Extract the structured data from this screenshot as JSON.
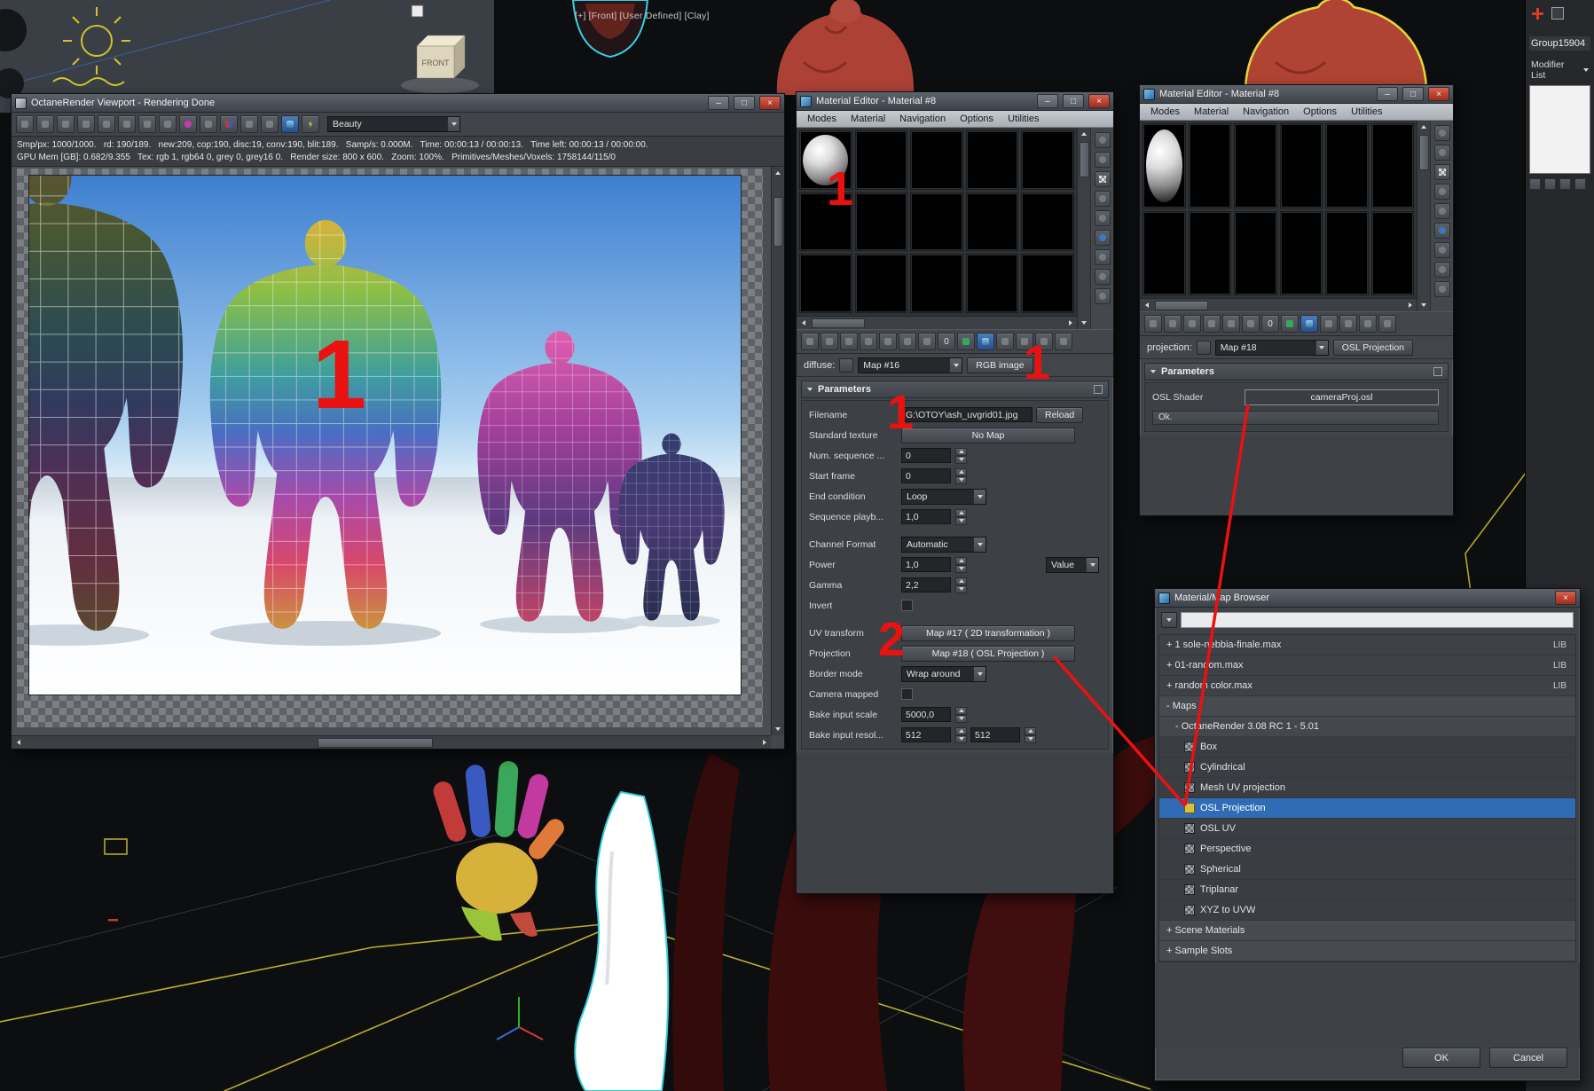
{
  "colors": {
    "annotation_red": "#ea1111",
    "selection_blue": "#2f6cb5",
    "close_button_red": "#a12c1c",
    "window_panel": "#42454a",
    "viewport_background": "#0d0e10"
  },
  "window_controls": {
    "minimize": "–",
    "maximize": "□",
    "close": "×"
  },
  "viewport": {
    "label": "[+] [Front] [User Defined] [Clay]",
    "gizmo_label": "FRONT",
    "scene_group": "Group15904",
    "modifier_list": "Modifier List"
  },
  "annotations": {
    "marks": [
      {
        "text": "1"
      },
      {
        "text": "1"
      },
      {
        "text": "1"
      },
      {
        "text": "1"
      },
      {
        "text": "2"
      }
    ]
  },
  "octane_window": {
    "title": "OctaneRender Viewport - Rendering Done",
    "render_pass": "Beauty",
    "stats_line1": "Smp/px: 1000/1000.   rd: 190/189.   new:209, cop:190, disc:19, conv:190, blit:189.   Samp/s: 0.000M.   Time: 00:00:13 / 00:00:13.   Time left: 00:00:13 / 00:00:00.",
    "stats_line2": "GPU Mem [GB]: 0.682/9.355   Tex: rgb 1, rgb64 0, grey 0, grey16 0.   Render size: 800 x 600.   Zoom: 100%.   Primitives/Meshes/Voxels: 1758144/115/0",
    "toolbar_icons": [
      "render-settings-icon",
      "save-image-icon",
      "copy-image-icon",
      "lock-resolution-icon",
      "pause-render-icon",
      "restart-render-icon",
      "stop-render-icon",
      "focus-picker-icon",
      "material-picker-icon",
      "white-balance-picker-icon",
      "render-region-icon",
      "film-region-icon",
      "clay-mode-icon",
      "render-passes-icon",
      "subsample-icon"
    ]
  },
  "material_editor_left": {
    "title": "Material Editor - Material #8",
    "menus": [
      "Modes",
      "Material",
      "Navigation",
      "Options",
      "Utilities"
    ],
    "channel": {
      "label": "diffuse:",
      "map": "Map #16",
      "type_button": "RGB image"
    },
    "toolbar": {
      "material_id": "0"
    },
    "toolbar_icons": [
      "get-material-icon",
      "put-to-scene-icon",
      "assign-to-selection-icon",
      "reset-map-icon",
      "make-unique-icon",
      "put-to-library-icon",
      "material-id-channel-icon",
      "show-map-in-viewport-icon",
      "show-end-result-icon",
      "go-to-parent-icon",
      "go-forward-sibling-icon",
      "material-id-badge",
      "sample-uv-tiling-icon",
      "pin-panel-icon"
    ],
    "side_icons": [
      "sample-type-icon",
      "backlight-icon",
      "background-checker-icon",
      "sample-tiling-icon",
      "video-color-check-icon",
      "make-preview-icon",
      "editor-options-icon",
      "select-by-material-icon",
      "material-map-navigator-icon"
    ],
    "parameters": {
      "header": "Parameters",
      "filename": {
        "label": "Filename",
        "value": "G:\\OTOY\\ash_uvgrid01.jpg",
        "button": "Reload"
      },
      "standard_texture": {
        "label": "Standard texture",
        "value": "No Map"
      },
      "num_sequence": {
        "label": "Num. sequence ...",
        "value": "0"
      },
      "start_frame": {
        "label": "Start frame",
        "value": "0"
      },
      "end_condition": {
        "label": "End condition",
        "value": "Loop"
      },
      "sequence_playback": {
        "label": "Sequence playb...",
        "value": "1,0"
      },
      "channel_format": {
        "label": "Channel Format",
        "value": "Automatic"
      },
      "power": {
        "label": "Power",
        "value": "1,0",
        "mode": "Value"
      },
      "gamma": {
        "label": "Gamma",
        "value": "2,2"
      },
      "invert": {
        "label": "Invert",
        "checked": false
      },
      "uv_transform": {
        "label": "UV transform",
        "value": "Map #17  ( 2D transformation )"
      },
      "projection": {
        "label": "Projection",
        "value": "Map #18  ( OSL Projection )"
      },
      "border_mode": {
        "label": "Border mode",
        "value": "Wrap around"
      },
      "camera_mapped": {
        "label": "Camera mapped",
        "checked": false
      },
      "bake_input_scale": {
        "label": "Bake input scale",
        "value": "5000,0"
      },
      "bake_input_resolution": {
        "label": "Bake input resol...",
        "value1": "512",
        "value2": "512"
      }
    }
  },
  "material_editor_right": {
    "title": "Material Editor - Material #8",
    "menus": [
      "Modes",
      "Material",
      "Navigation",
      "Options",
      "Utilities"
    ],
    "channel": {
      "label": "projection:",
      "map": "Map #18",
      "type_button": "OSL Projection"
    },
    "toolbar": {
      "material_id": "0"
    },
    "parameters": {
      "header": "Parameters",
      "osl_shader": {
        "label": "OSL Shader",
        "value": "cameraProj.osl"
      },
      "ok_button": "Ok."
    }
  },
  "map_browser": {
    "title": "Material/Map Browser",
    "search_value": "",
    "rows": [
      {
        "label": "+ 1 sole-nebbia-finale.max",
        "tag": "LIB"
      },
      {
        "label": "+ 01-random.max",
        "tag": "LIB"
      },
      {
        "label": "+ random color.max",
        "tag": "LIB"
      },
      {
        "label": "- Maps"
      },
      {
        "label": "- OctaneRender 3.08 RC 1 - 5.01"
      },
      {
        "label": "Box"
      },
      {
        "label": "Cylindrical"
      },
      {
        "label": "Mesh UV projection"
      },
      {
        "label": "OSL Projection"
      },
      {
        "label": "OSL UV"
      },
      {
        "label": "Perspective"
      },
      {
        "label": "Spherical"
      },
      {
        "label": "Triplanar"
      },
      {
        "label": "XYZ to UVW"
      },
      {
        "label": "+ Scene Materials"
      },
      {
        "label": "+ Sample Slots"
      }
    ],
    "ok": "OK",
    "cancel": "Cancel"
  }
}
